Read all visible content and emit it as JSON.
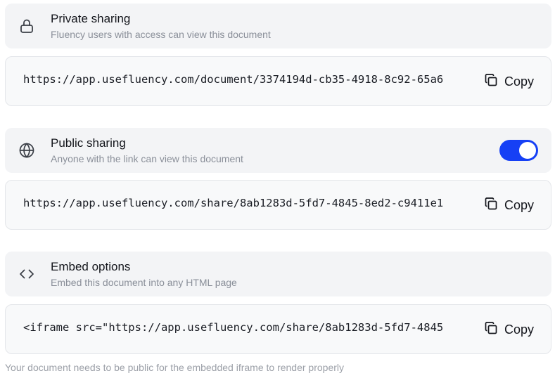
{
  "private_sharing": {
    "icon": "lock-icon",
    "title": "Private sharing",
    "subtitle": "Fluency users with access can view this document",
    "url": "https://app.usefluency.com/document/3374194d-cb35-4918-8c92-65a6",
    "copy_label": "Copy"
  },
  "public_sharing": {
    "icon": "globe-icon",
    "title": "Public sharing",
    "subtitle": "Anyone with the link can view this document",
    "toggle_on": true,
    "accent_color": "#1640f5",
    "url": "https://app.usefluency.com/share/8ab1283d-5fd7-4845-8ed2-c9411e1",
    "copy_label": "Copy"
  },
  "embed_options": {
    "icon": "code-icon",
    "title": "Embed options",
    "subtitle": "Embed this document into any HTML page",
    "code": "<iframe src=\"https://app.usefluency.com/share/8ab1283d-5fd7-4845",
    "copy_label": "Copy"
  },
  "footnote": "Your document needs to be public for the embedded iframe to render properly"
}
